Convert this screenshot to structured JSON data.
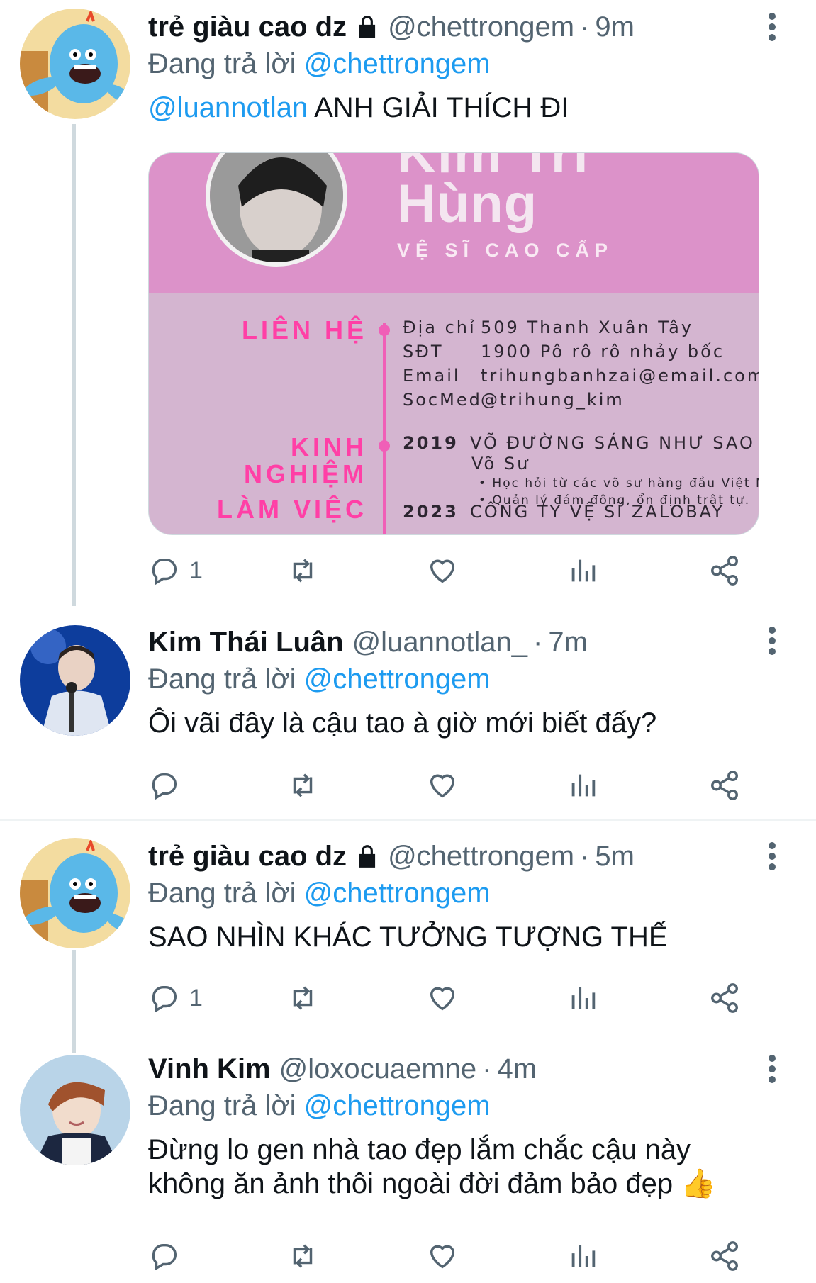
{
  "tweets": [
    {
      "name": "trẻ giàu cao dz",
      "handle": "@chettrongem",
      "time": "9m",
      "reply_prefix": "Đang trả lời",
      "reply_to": "@chettrongem",
      "mention": "@luannotlan",
      "text": "ANH GIẢI THÍCH ĐI",
      "replies": "1",
      "avatar": "blue-cartoon-avatar"
    },
    {
      "name": "Kim Thái Luân",
      "handle": "@luannotlan_",
      "time": "7m",
      "reply_prefix": "Đang trả lời",
      "reply_to": "@chettrongem",
      "text": "Ôi vãi đây là cậu tao à giờ mới biết đấy?",
      "replies": "",
      "avatar": "singer-photo-avatar"
    },
    {
      "name": "trẻ giàu cao dz",
      "handle": "@chettrongem",
      "time": "5m",
      "reply_prefix": "Đang trả lời",
      "reply_to": "@chettrongem",
      "text": "SAO NHÌN KHÁC TƯỞNG TƯỢNG THẾ",
      "replies": "1",
      "avatar": "blue-cartoon-avatar"
    },
    {
      "name": "Vinh Kim",
      "handle": "@loxocuaemne",
      "time": "4m",
      "reply_prefix": "Đang trả lời",
      "reply_to": "@chettrongem",
      "text_line1": "Đừng lo gen nhà tao đẹp lắm chắc cậu này",
      "text_line2": "không ăn ảnh thôi ngoài đời đảm bảo đẹp",
      "emoji": "👍",
      "replies": "",
      "avatar": "boy-photo-avatar"
    }
  ],
  "card": {
    "name_top": "Kim Trí",
    "name": "Hùng",
    "title": "VỆ SĨ CAO CẤP",
    "contact_heading": "LIÊN HỆ",
    "contact": [
      {
        "k": "Địa chỉ",
        "v": "509 Thanh Xuân Tây"
      },
      {
        "k": "SĐT",
        "v": "1900 Pô rô rô nhảy bốc"
      },
      {
        "k": "Email",
        "v": "trihungbanhzai@email.com"
      },
      {
        "k": "SocMed",
        "v": "@trihung_kim"
      }
    ],
    "exp_heading_1": "KINH",
    "exp_heading_2": "NGHIỆM",
    "exp_heading_3": "LÀM VIỆC",
    "exp1_year": "2019",
    "exp1_title": "VÕ ĐƯỜNG SÁNG NHƯ SAO",
    "exp1_role": "Võ Sư",
    "exp1_b1": "• Học hỏi từ các võ sư hàng đầu Việt Nam.",
    "exp1_b2": "• Quản lý đám đông, ổn định trật tự.",
    "exp2_year": "2023",
    "exp2_title": "CÔNG TY VỆ SĨ ZALOBAY"
  },
  "colors": {
    "link": "#1d9bf0",
    "muted": "#536471",
    "card_pink": "#dc92c9",
    "card_mauve": "#d4b5d0",
    "card_accent": "#ff3fa6"
  },
  "icons": [
    "lock-icon",
    "more-icon",
    "reply-icon",
    "retweet-icon",
    "like-icon",
    "views-icon",
    "share-icon"
  ]
}
